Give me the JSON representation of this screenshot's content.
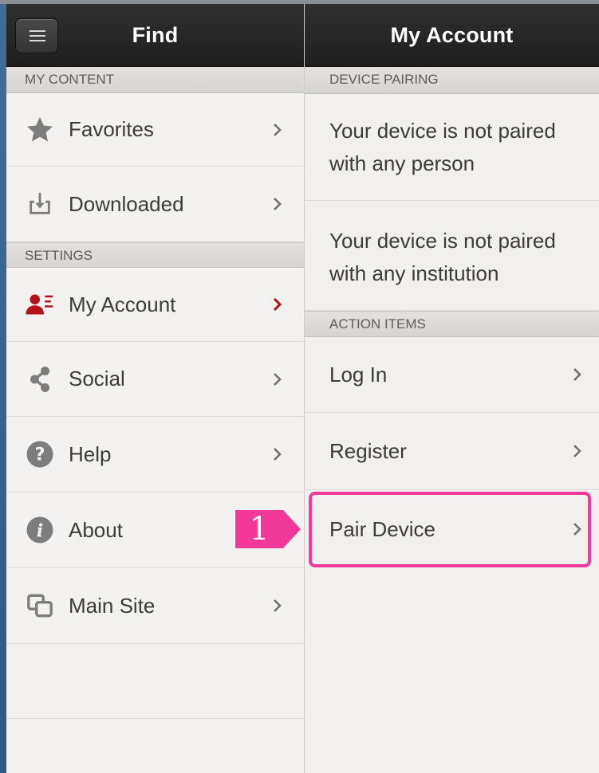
{
  "left_panel": {
    "header_title": "Find",
    "sections": [
      {
        "label": "MY CONTENT",
        "items": [
          {
            "label": "Favorites",
            "icon": "star-icon"
          },
          {
            "label": "Downloaded",
            "icon": "download-icon"
          }
        ]
      },
      {
        "label": "SETTINGS",
        "items": [
          {
            "label": "My Account",
            "icon": "account-icon",
            "active": true
          },
          {
            "label": "Social",
            "icon": "share-icon"
          },
          {
            "label": "Help",
            "icon": "help-icon"
          },
          {
            "label": "About",
            "icon": "info-icon"
          },
          {
            "label": "Main Site",
            "icon": "external-site-icon"
          }
        ]
      }
    ]
  },
  "right_panel": {
    "header_title": "My Account",
    "device_pairing": {
      "label": "DEVICE PAIRING",
      "messages": [
        "Your device is not paired with any person",
        "Your device is not paired with any institution"
      ]
    },
    "action_items": {
      "label": "ACTION ITEMS",
      "items": [
        "Log In",
        "Register",
        "Pair Device"
      ]
    }
  },
  "callout": {
    "number": "1",
    "target": "Pair Device"
  },
  "colors": {
    "accent_active": "#b3121b",
    "callout": "#f2399a",
    "header_bg": "#262626",
    "text": "#3b3b3b",
    "icon_gray": "#7d7d7d"
  }
}
